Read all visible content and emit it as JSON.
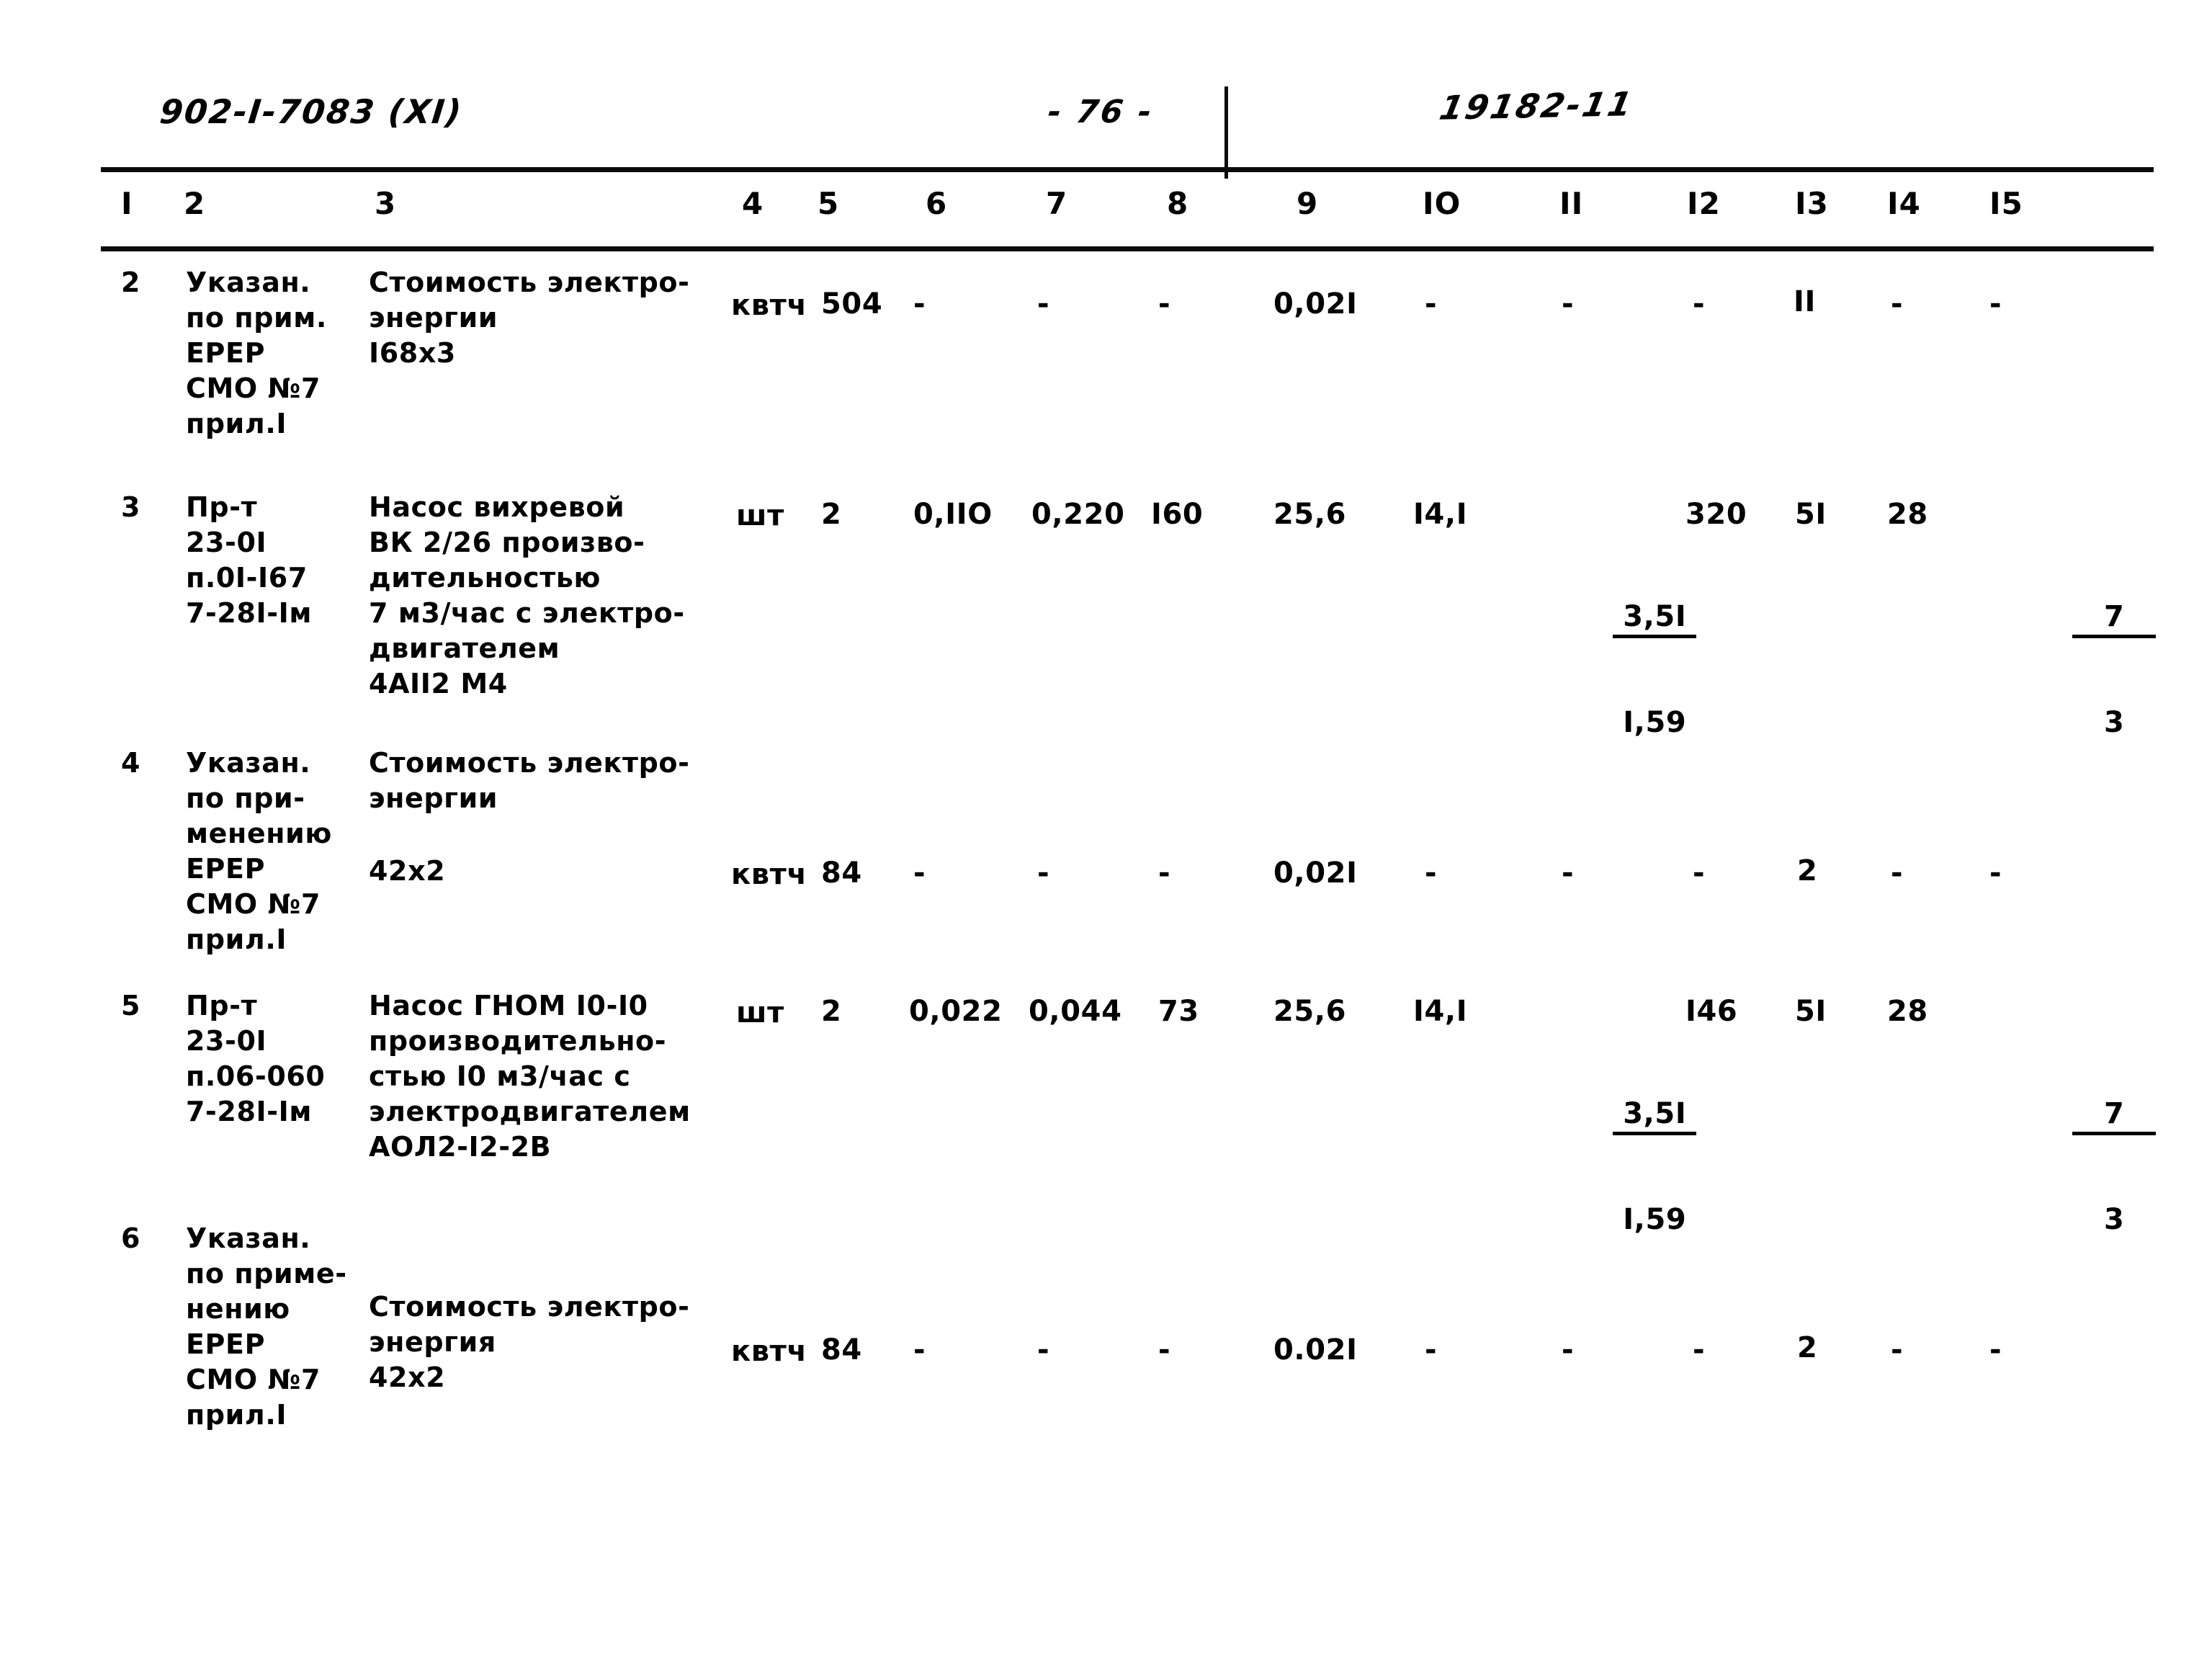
{
  "header": {
    "doc_code": "902-I-7083 (XI)",
    "page_number": "- 76 -",
    "hand_note": "19182-11"
  },
  "table": {
    "column_headers": [
      "I",
      "2",
      "3",
      "4",
      "5",
      "6",
      "7",
      "8",
      "9",
      "IO",
      "II",
      "I2",
      "I3",
      "I4",
      "I5"
    ],
    "rows": [
      {
        "no": "2",
        "col2": "Указан.\nпо прим.\nЕРЕР\nСМО №7\nприл.I",
        "col3": "Стоимость электро-\nэнергии\nI68х3",
        "col4": "квтч",
        "col5": "504",
        "col6": "-",
        "col7": "-",
        "col8": "-",
        "col9": "0,02I",
        "col10": "-",
        "col11": "-",
        "col12": "-",
        "col13": "II",
        "col14": "-",
        "col15": "-"
      },
      {
        "no": "3",
        "col2": "Пр-т\n23-0I\nп.0I-I67\n7-28I-Iм",
        "col3": "Насос вихревой\nВК 2/26 произво-\nдительностью\n7 м3/час с электро-\nдвигателем\n4АII2 М4",
        "col4": "шт",
        "col5": "2",
        "col6": "0,IIO",
        "col7": "0,220",
        "col8": "I60",
        "col9": "25,6",
        "col10": "I4,I",
        "col11_top": "3,5I",
        "col11_bottom": "I,59",
        "col12": "320",
        "col13": "5I",
        "col14": "28",
        "col15_top": "7",
        "col15_bottom": "3"
      },
      {
        "no": "4",
        "col2": "Указан.\nпо при-\nменению\nЕРЕР\nСМО №7\nприл.I",
        "col3_a": "Стоимость электро-\nэнергии",
        "col3_b": "42х2",
        "col4": "квтч",
        "col5": "84",
        "col6": "-",
        "col7": "-",
        "col8": "-",
        "col9": "0,02I",
        "col10": "-",
        "col11": "-",
        "col12": "-",
        "col13": "2",
        "col14": "-",
        "col15": "-"
      },
      {
        "no": "5",
        "col2": "Пр-т\n23-0I\nп.06-060\n7-28I-Iм",
        "col3": "Насос ГНОМ I0-I0\nпроизводительно-\nстью I0 м3/час с\nэлектродвигателем\nАОЛ2-I2-2В",
        "col4": "шт",
        "col5": "2",
        "col6": "0,022",
        "col7": "0,044",
        "col8": "73",
        "col9": "25,6",
        "col10": "I4,I",
        "col11_top": "3,5I",
        "col11_bottom": "I,59",
        "col12": "I46",
        "col13": "5I",
        "col14": "28",
        "col15_top": "7",
        "col15_bottom": "3"
      },
      {
        "no": "6",
        "col2": "Указан.\nпо приме-\nнению\nЕРЕР\nСМО №7\nприл.I",
        "col3_a": "Стоимость электро-\nэнергия",
        "col3_b": "42х2",
        "col4": "квтч",
        "col5": "84",
        "col6": "-",
        "col7": "-",
        "col8": "-",
        "col9": "0.02I",
        "col10": "-",
        "col11": "-",
        "col12": "-",
        "col13": "2",
        "col14": "-",
        "col15": "-"
      }
    ]
  }
}
